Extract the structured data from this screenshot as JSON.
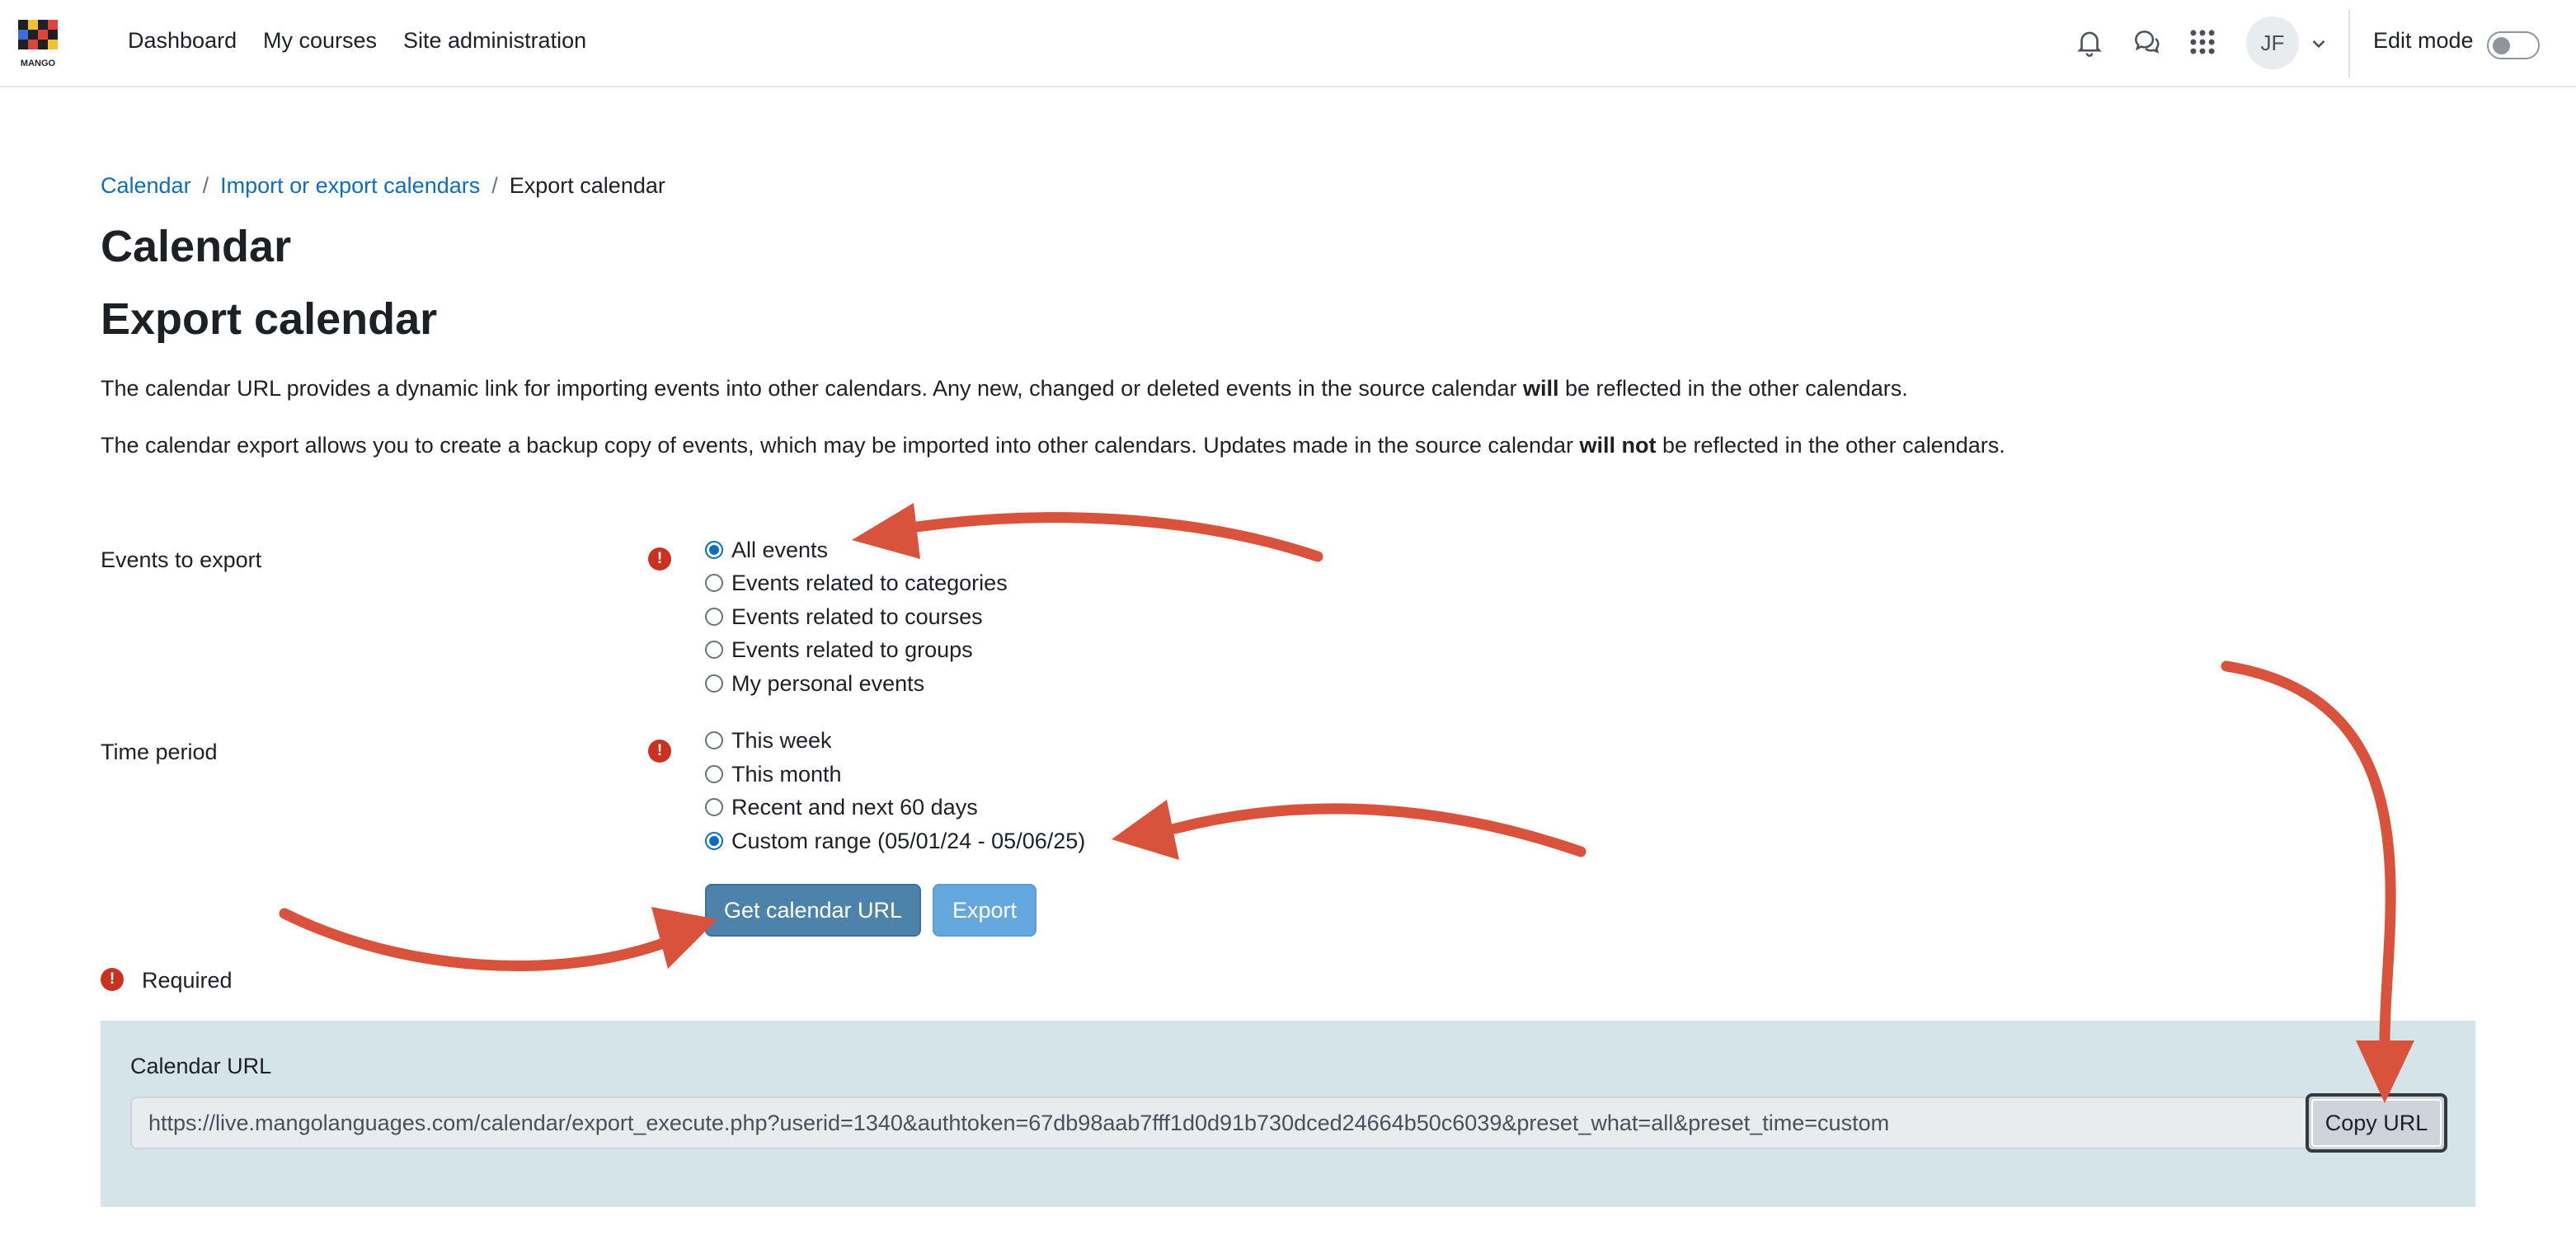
{
  "nav": {
    "logo_text": "MANGO",
    "links": [
      "Dashboard",
      "My courses",
      "Site administration"
    ],
    "avatar_initials": "JF",
    "edit_mode_label": "Edit mode",
    "edit_mode_on": false
  },
  "breadcrumb": [
    "Calendar",
    "Import or export calendars",
    "Export calendar"
  ],
  "page_title": "Calendar",
  "section_title": "Export calendar",
  "description": {
    "line1_pre": "The calendar URL provides a dynamic link for importing events into other calendars. Any new, changed or deleted events in the source calendar ",
    "line1_bold": "will",
    "line1_post": " be reflected in the other calendars.",
    "line2_pre": "The calendar export allows you to create a backup copy of events, which may be imported into other calendars. Updates made in the source calendar ",
    "line2_bold": "will not",
    "line2_post": " be reflected in the other calendars."
  },
  "form": {
    "events_label": "Events to export",
    "events_options": [
      "All events",
      "Events related to categories",
      "Events related to courses",
      "Events related to groups",
      "My personal events"
    ],
    "events_selected": 0,
    "time_label": "Time period",
    "time_options": [
      "This week",
      "This month",
      "Recent and next 60 days",
      "Custom range (05/01/24 - 05/06/25)"
    ],
    "time_selected": 3,
    "required_icon": "!",
    "get_url_button": "Get calendar URL",
    "export_button": "Export",
    "required_note": "Required"
  },
  "calendar_url": {
    "label": "Calendar URL",
    "value": "https://live.mangolanguages.com/calendar/export_execute.php?userid=1340&authtoken=67db98aab7fff1d0d91b730dced24664b50c6039&preset_what=all&preset_time=custom",
    "copy_button": "Copy URL"
  },
  "colors": {
    "link": "#0f6cbf",
    "primary_button": "#4d82ab",
    "secondary_button": "#64a8de",
    "required": "#ca3120",
    "annotation_arrow": "#d9533c",
    "url_panel_bg": "#d5e4e9"
  }
}
